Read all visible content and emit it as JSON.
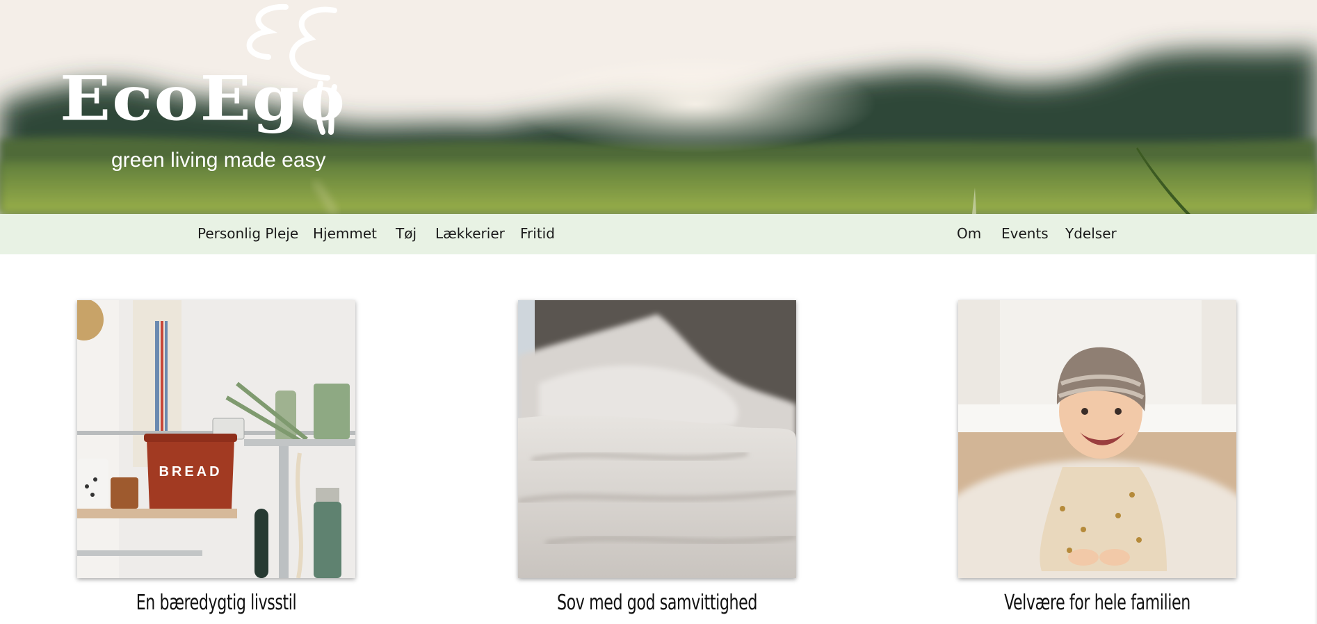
{
  "brand": {
    "name": "EcoEgo",
    "tagline": "green living made easy"
  },
  "nav": {
    "left_items": [
      {
        "label": "Personlig Pleje"
      },
      {
        "label": "Hjemmet"
      },
      {
        "label": "Tøj"
      },
      {
        "label": "Lækkerier"
      },
      {
        "label": "Fritid"
      }
    ],
    "right_items": [
      {
        "label": "Om"
      },
      {
        "label": "Events"
      },
      {
        "label": "Ydelser"
      }
    ]
  },
  "cards": [
    {
      "title": "En bæredygtig livsstil",
      "image": "kitchen-shelf-bread-tin"
    },
    {
      "title": "Sov med god samvittighed",
      "image": "white-bedding"
    },
    {
      "title": "Velvære for hele familien",
      "image": "smiling-baby"
    }
  ],
  "colors": {
    "nav_background": "#e8f2e4",
    "text": "#1b1b1b"
  }
}
